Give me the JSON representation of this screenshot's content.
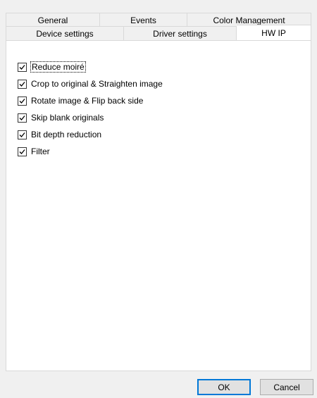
{
  "tabs": {
    "back": [
      "General",
      "Events",
      "Color Management"
    ],
    "front": [
      "Device settings",
      "Driver settings",
      "HW IP"
    ],
    "active": "HW IP"
  },
  "options": [
    {
      "label": "Reduce moiré",
      "checked": true
    },
    {
      "label": "Crop to original & Straighten image",
      "checked": true
    },
    {
      "label": "Rotate image & Flip back side",
      "checked": true
    },
    {
      "label": "Skip blank originals",
      "checked": true
    },
    {
      "label": "Bit depth reduction",
      "checked": true
    },
    {
      "label": "Filter",
      "checked": true
    }
  ],
  "buttons": {
    "ok": "OK",
    "cancel": "Cancel"
  }
}
